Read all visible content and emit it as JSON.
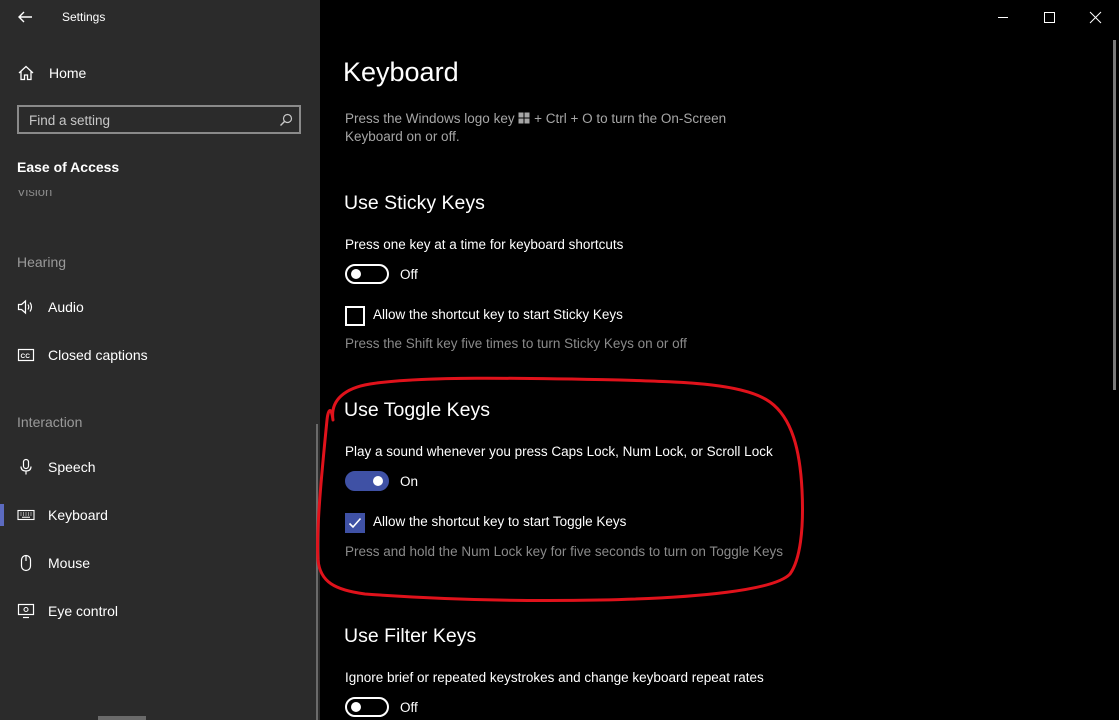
{
  "app": {
    "title": "Settings"
  },
  "sidebar": {
    "home_label": "Home",
    "search_placeholder": "Find a setting",
    "section_title": "Ease of Access",
    "cut_item": "Vision",
    "groups": {
      "hearing": "Hearing",
      "interaction": "Interaction"
    },
    "items": [
      {
        "label": "Audio",
        "icon": "speaker-icon"
      },
      {
        "label": "Closed captions",
        "icon": "cc-icon"
      },
      {
        "label": "Speech",
        "icon": "microphone-icon"
      },
      {
        "label": "Keyboard",
        "icon": "keyboard-icon",
        "selected": true
      },
      {
        "label": "Mouse",
        "icon": "mouse-icon"
      },
      {
        "label": "Eye control",
        "icon": "eye-control-icon"
      }
    ]
  },
  "main": {
    "title": "Keyboard",
    "intro_before": "Press the Windows logo key",
    "intro_after": "+ Ctrl + O to turn the On-Screen Keyboard on or off.",
    "sticky": {
      "header": "Use Sticky Keys",
      "desc": "Press one key at a time for keyboard shortcuts",
      "toggle_state": "Off",
      "shortcut_label": "Allow the shortcut key to start Sticky Keys",
      "shortcut_checked": false,
      "help": "Press the Shift key five times to turn Sticky Keys on or off"
    },
    "toggle_keys": {
      "header": "Use Toggle Keys",
      "desc": "Play a sound whenever you press Caps Lock, Num Lock, or Scroll Lock",
      "toggle_state": "On",
      "shortcut_label": "Allow the shortcut key to start Toggle Keys",
      "shortcut_checked": true,
      "help": "Press and hold the Num Lock key for five seconds to turn on Toggle Keys"
    },
    "filter": {
      "header": "Use Filter Keys",
      "desc": "Ignore brief or repeated keystrokes and change keyboard repeat rates",
      "toggle_state": "Off"
    }
  },
  "colors": {
    "accent": "#3f51a5",
    "annotation": "#e0121b",
    "sidebar_bg": "#2b2b2b",
    "main_bg": "#000000"
  }
}
